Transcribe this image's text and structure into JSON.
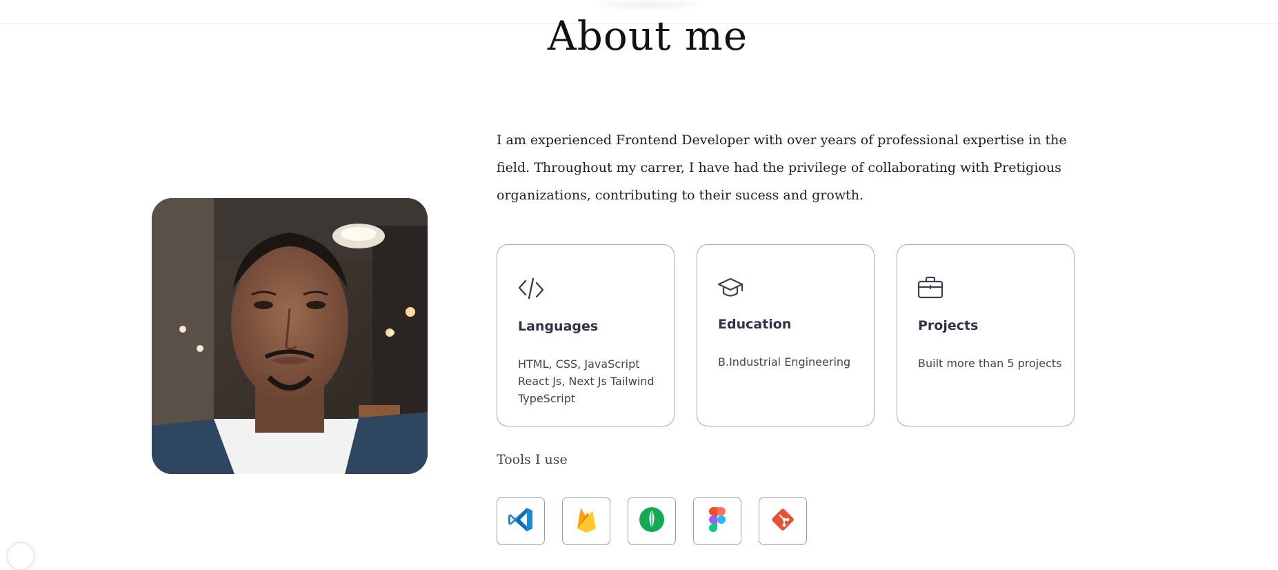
{
  "page": {
    "title": "About me",
    "intro": "I am experienced Frontend Developer with over years of professional expertise in the field. Throughout my carrer, I have had the privilege of collaborating with Pretigious organizations, contributing to their sucess and growth."
  },
  "cards": [
    {
      "icon": "code-icon",
      "title": "Languages",
      "desc": "HTML, CSS, JavaScript React Js, Next Js Tailwind TypeScript"
    },
    {
      "icon": "graduation-cap-icon",
      "title": "Education",
      "desc": "B.Industrial Engineering"
    },
    {
      "icon": "briefcase-icon",
      "title": "Projects",
      "desc": "Built more than 5 projects"
    }
  ],
  "tools": {
    "label": "Tools I use",
    "items": [
      "vscode-icon",
      "firebase-icon",
      "mongodb-icon",
      "figma-icon",
      "git-icon"
    ]
  },
  "colors": {
    "card_border": "#a9aab0",
    "card_title": "#2e3447",
    "vscode": "#1a8ad4",
    "firebase": "#f5b820",
    "mongodb": "#13aa52",
    "git": "#e94f32"
  }
}
